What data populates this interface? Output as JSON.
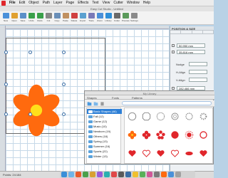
{
  "menu": {
    "app": "File",
    "items": [
      "Edit",
      "Object",
      "Path",
      "Layer",
      "Page",
      "Effects",
      "Text",
      "View",
      "Cutter",
      "Window",
      "Help"
    ]
  },
  "window": {
    "title": "Easy Cut Studio - Untitled"
  },
  "toolbar": {
    "buttons": [
      {
        "label": "New",
        "color": "#4a90d9"
      },
      {
        "label": "Open",
        "color": "#e0a030"
      },
      {
        "label": "Save",
        "color": "#5a8fc8"
      },
      {
        "label": "Undo",
        "color": "#3aa04a"
      },
      {
        "label": "Redo",
        "color": "#3aa04a"
      },
      {
        "label": "Cut",
        "color": "#888888"
      },
      {
        "label": "Copy",
        "color": "#6a8fb8"
      },
      {
        "label": "Paste",
        "color": "#c09060"
      },
      {
        "label": "Delete",
        "color": "#d04040"
      },
      {
        "label": "Import",
        "color": "#5aa0d0"
      },
      {
        "label": "Trace",
        "color": "#7a7ab8"
      },
      {
        "label": "Zoom",
        "color": "#4a90d9"
      },
      {
        "label": "Library",
        "color": "#2f8fd8"
      },
      {
        "label": "Cutter",
        "color": "#6a6a6a"
      },
      {
        "label": "Preview",
        "color": "#5a9a5a"
      },
      {
        "label": "Settings",
        "color": "#8a8a8a"
      }
    ]
  },
  "right_panel": {
    "header": "POSITION & SIZE",
    "tabs": [
      "",
      "",
      "",
      ""
    ],
    "width_value": "50.950 mm",
    "height_value": "35.816 mm",
    "nudge_label": "Nudge",
    "h_align_label": "H-Align",
    "v_align_label": "V-Align",
    "size_value": "282.466 mm",
    "section2": "Transform"
  },
  "canvas": {
    "shape": "flower",
    "petal_color": "#ff6a0e",
    "center_color": "#ffe01a"
  },
  "library": {
    "title": "My Library",
    "tab_shapes": "Shapes",
    "tab_fonts": "Fonts",
    "tab_patterns": "Patterns",
    "tree": [
      {
        "label": "Basic Shapes (46)",
        "selected": true
      },
      {
        "label": "Fall (12)",
        "selected": false
      },
      {
        "label": "Game (12)",
        "selected": false
      },
      {
        "label": "Music (10)",
        "selected": false
      },
      {
        "label": "Newborn (19)",
        "selected": false
      },
      {
        "label": "Others (18)",
        "selected": false
      },
      {
        "label": "Spring (13)",
        "selected": false
      },
      {
        "label": "Summer (16)",
        "selected": false
      },
      {
        "label": "Sports (22)",
        "selected": false
      },
      {
        "label": "Winter (13)",
        "selected": false
      }
    ],
    "shape_icons": [
      "circle",
      "octagon",
      "badge",
      "flower",
      "flower",
      "gear",
      "flower",
      "flower",
      "flower",
      "sun",
      "swirl",
      "cross",
      "heart",
      "heart-outline",
      "heart",
      "heart-outline",
      "lips",
      "heart"
    ]
  },
  "status": {
    "left": "Points: 24:184"
  }
}
